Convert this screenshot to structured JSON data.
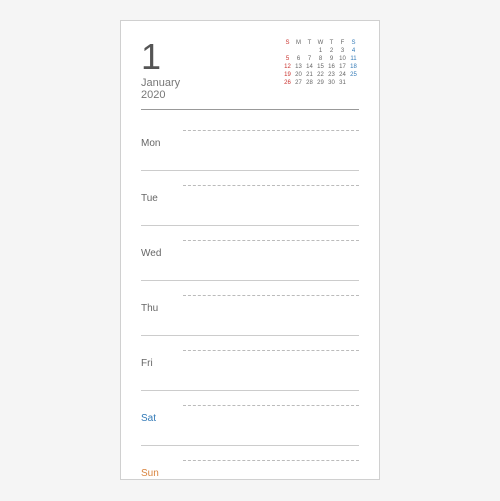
{
  "header": {
    "month_number": "1",
    "month_name": "January",
    "year": "2020"
  },
  "mini_calendar": {
    "headers": [
      "S",
      "M",
      "T",
      "W",
      "T",
      "F",
      "S"
    ],
    "rows": [
      [
        "",
        "",
        "",
        "1",
        "2",
        "3",
        "4"
      ],
      [
        "5",
        "6",
        "7",
        "8",
        "9",
        "10",
        "11"
      ],
      [
        "12",
        "13",
        "14",
        "15",
        "16",
        "17",
        "18"
      ],
      [
        "19",
        "20",
        "21",
        "22",
        "23",
        "24",
        "25"
      ],
      [
        "26",
        "27",
        "28",
        "29",
        "30",
        "31",
        ""
      ]
    ]
  },
  "days": [
    {
      "label": "Mon",
      "class": ""
    },
    {
      "label": "Tue",
      "class": ""
    },
    {
      "label": "Wed",
      "class": ""
    },
    {
      "label": "Thu",
      "class": ""
    },
    {
      "label": "Fri",
      "class": ""
    },
    {
      "label": "Sat",
      "class": "sat"
    },
    {
      "label": "Sun",
      "class": "sun"
    }
  ]
}
